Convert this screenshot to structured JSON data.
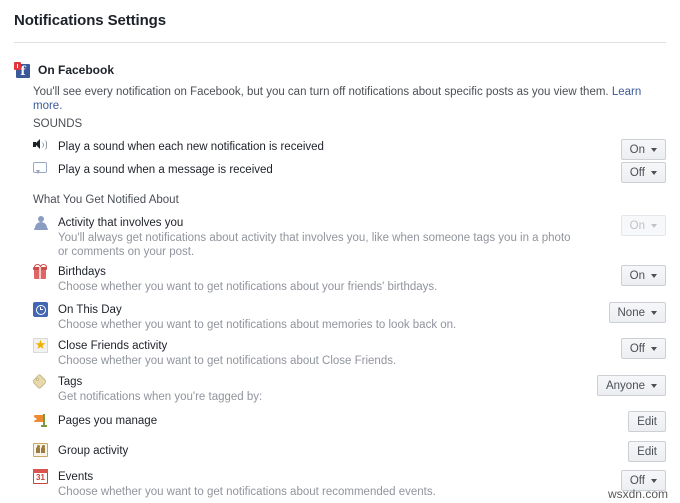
{
  "page": {
    "title": "Notifications Settings",
    "watermark": "wsxdn.com"
  },
  "section": {
    "icon": "facebook-icon",
    "heading": "On Facebook",
    "description_before_link": "You'll see every notification on Facebook, but you can turn off notifications about specific posts as you view them. ",
    "link_label": "Learn more."
  },
  "groups": {
    "sounds_heading": "SOUNDS",
    "notified_heading": "What You Get Notified About"
  },
  "sounds": [
    {
      "icon": "speaker-icon",
      "title": "Play a sound when each new notification is received",
      "control": {
        "type": "dropdown",
        "value": "On",
        "disabled": false
      }
    },
    {
      "icon": "message-bubble-icon",
      "title": "Play a sound when a message is received",
      "control": {
        "type": "dropdown",
        "value": "Off",
        "disabled": false
      }
    }
  ],
  "notified": [
    {
      "icon": "person-icon",
      "title": "Activity that involves you",
      "subtitle": "You'll always get notifications about activity that involves you, like when someone tags you in a photo or comments on your post.",
      "control": {
        "type": "dropdown",
        "value": "On",
        "disabled": true
      }
    },
    {
      "icon": "gift-icon",
      "title": "Birthdays",
      "subtitle": "Choose whether you want to get notifications about your friends' birthdays.",
      "control": {
        "type": "dropdown",
        "value": "On",
        "disabled": false
      }
    },
    {
      "icon": "clock-icon",
      "title": "On This Day",
      "subtitle": "Choose whether you want to get notifications about memories to look back on.",
      "control": {
        "type": "dropdown",
        "value": "None",
        "disabled": false
      }
    },
    {
      "icon": "star-icon",
      "title": "Close Friends activity",
      "subtitle": "Choose whether you want to get notifications about Close Friends.",
      "control": {
        "type": "dropdown",
        "value": "Off",
        "disabled": false
      }
    },
    {
      "icon": "tag-icon",
      "title": "Tags",
      "subtitle": "Get notifications when you're tagged by:",
      "control": {
        "type": "dropdown",
        "value": "Anyone",
        "disabled": false
      }
    },
    {
      "icon": "flag-icon",
      "title": "Pages you manage",
      "subtitle": "",
      "control": {
        "type": "button",
        "value": "Edit",
        "disabled": false
      }
    },
    {
      "icon": "group-icon",
      "title": "Group activity",
      "subtitle": "",
      "control": {
        "type": "button",
        "value": "Edit",
        "disabled": false
      }
    },
    {
      "icon": "calendar-icon",
      "title": "Events",
      "subtitle": "Choose whether you want to get notifications about recommended events.",
      "control": {
        "type": "dropdown",
        "value": "Off",
        "disabled": false
      }
    }
  ],
  "calendar_icon_day": "31",
  "colors": {
    "facebook_blue": "#3b5998",
    "link_blue": "#3b5998",
    "text_primary": "#1d2129",
    "text_secondary": "#4b4f56",
    "text_muted": "#90949c",
    "border": "#dddfe2"
  }
}
